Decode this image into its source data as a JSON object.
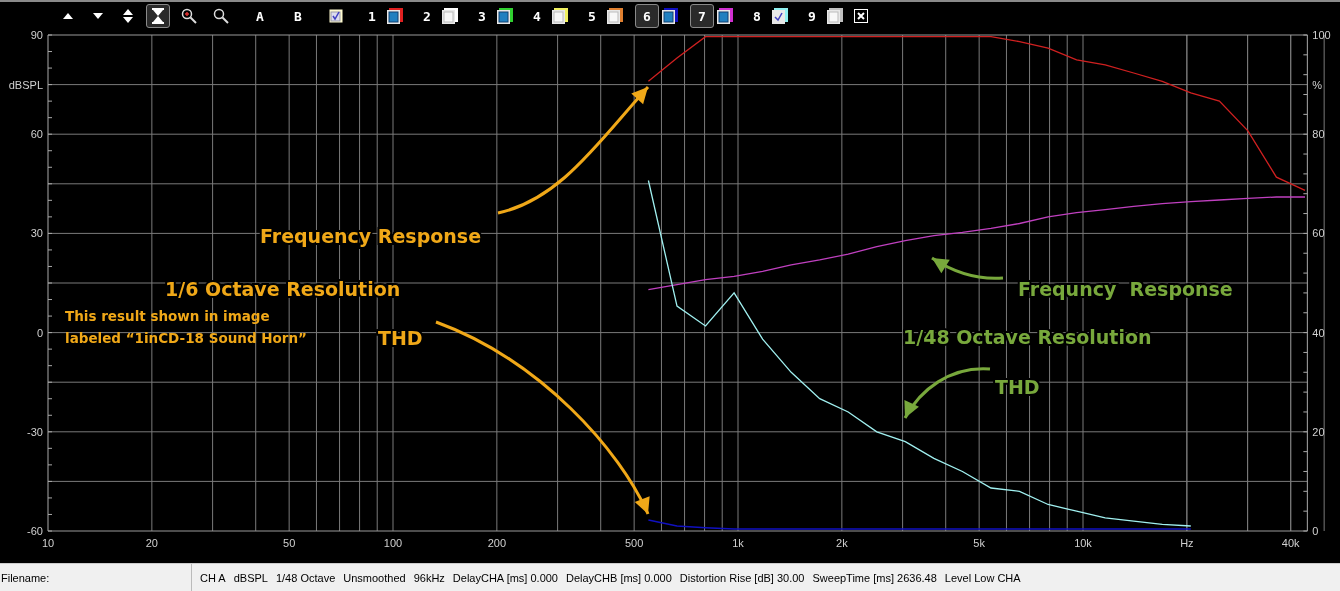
{
  "toolbar": [
    {
      "kind": "up",
      "selected": false
    },
    {
      "kind": "down",
      "selected": false
    },
    {
      "kind": "updown",
      "selected": false
    },
    {
      "kind": "fit",
      "selected": true
    },
    {
      "kind": "zoom-in",
      "selected": false
    },
    {
      "kind": "zoom-out",
      "selected": false
    },
    {
      "kind": "letter",
      "label": "A",
      "selected": false
    },
    {
      "kind": "letter",
      "label": "B",
      "selected": false
    },
    {
      "kind": "check",
      "checked": true
    },
    {
      "kind": "channel",
      "label": "1",
      "color": "#e02020",
      "shown": true,
      "checked": false,
      "selected": false
    },
    {
      "kind": "channel",
      "label": "2",
      "color": "#ffffff",
      "shown": false,
      "checked": false,
      "selected": false
    },
    {
      "kind": "channel",
      "label": "3",
      "color": "#30d030",
      "shown": true,
      "checked": false,
      "selected": false
    },
    {
      "kind": "channel",
      "label": "4",
      "color": "#f0f060",
      "shown": false,
      "checked": false,
      "selected": false
    },
    {
      "kind": "channel",
      "label": "5",
      "color": "#e08030",
      "shown": false,
      "checked": false,
      "selected": false
    },
    {
      "kind": "channel",
      "label": "6",
      "color": "#1010c0",
      "shown": true,
      "checked": false,
      "selected": true
    },
    {
      "kind": "channel",
      "label": "7",
      "color": "#d030d0",
      "shown": true,
      "checked": false,
      "selected": true
    },
    {
      "kind": "channel",
      "label": "8",
      "color": "#90f0f0",
      "checked": true,
      "selected": false
    },
    {
      "kind": "channel",
      "label": "9",
      "color": "#c0c0c0",
      "shown": false,
      "checked": false,
      "selected": false
    },
    {
      "kind": "close",
      "selected": false
    }
  ],
  "chart": {
    "chart_data": {
      "type": "line",
      "ylabel": "dBSPL",
      "y2label": "%",
      "grid": true,
      "series": [
        {
          "color": "#d02020",
          "values": [
            76,
            83,
            89.5,
            89.5,
            89.5,
            89.5,
            89.5,
            89.5,
            89.5,
            89.5,
            89.5,
            89.5,
            89.5,
            88,
            86,
            82.5,
            81,
            78.5,
            76,
            72.5,
            70,
            61,
            47,
            43
          ]
        },
        {
          "color": "#c040c0",
          "values": [
            13,
            14.5,
            16,
            17,
            18.5,
            20.5,
            22,
            23.7,
            26,
            27.8,
            29.3,
            30.3,
            31.5,
            33,
            35,
            36.3,
            37.2,
            38.2,
            39,
            39.6,
            40.1,
            40.6,
            41,
            41
          ]
        },
        {
          "color": "#a0f0f0",
          "values": [
            46,
            8,
            2,
            12,
            -2,
            -12,
            -20,
            -24,
            -30,
            -33,
            -38,
            -42,
            -47,
            -48,
            -52,
            -54,
            -56,
            -57,
            -58,
            -58.5,
            null,
            null,
            null,
            null
          ]
        },
        {
          "color": "#1010c0",
          "values": [
            -56.7,
            -58.5,
            -59,
            -59.4,
            -59.4,
            -59.4,
            -59.4,
            -59.4,
            -59.4,
            -59.4,
            -59.4,
            -59.4,
            -59.4,
            -59.4,
            -59.4,
            -59.4,
            -59.4,
            -59.4,
            -59.4,
            -59.4,
            null,
            null,
            null,
            null
          ]
        }
      ],
      "ylim": [
        -60,
        90
      ],
      "y2lim": [
        0,
        100
      ],
      "yticks": [
        -60,
        -30,
        0,
        30,
        60,
        90
      ],
      "y2ticks": [
        0,
        20,
        40,
        60,
        80,
        100
      ]
    },
    "x_axis_labels": [
      "10",
      "20",
      "50",
      "100",
      "200",
      "500",
      "1k",
      "2k",
      "5k",
      "10k",
      "Hz",
      "40k"
    ],
    "annotations": [
      {
        "text": "Frequency Response",
        "color": "#f0a818"
      },
      {
        "text": "1/6 Octave Resolution",
        "color": "#f0a818"
      },
      {
        "text": "This result shown in image labeled “1inCD-18 Sound Horn”",
        "color": "#f0a818"
      },
      {
        "text": "THD",
        "color": "#f0a818"
      },
      {
        "text": "Frequncy  Response",
        "color": "#78a83c"
      },
      {
        "text": "1/48 Octave Resolution",
        "color": "#78a83c"
      },
      {
        "text": "THD",
        "color": "#78a83c"
      }
    ]
  },
  "status_bar": {
    "filename_label": "Filename:",
    "fields": [
      "CH A",
      "dBSPL",
      "1/48 Octave",
      "Unsmoothed",
      "96kHz",
      "DelayCHA [ms] 0.000",
      "DelayCHB [ms] 0.000",
      "Distortion Rise [dB] 30.00",
      "SweepTime [ms] 2636.48",
      "Level Low CHA"
    ]
  }
}
